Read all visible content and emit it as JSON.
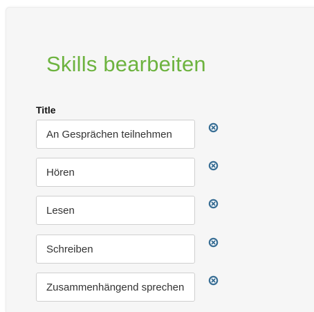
{
  "header": {
    "title": "Skills bearbeiten"
  },
  "form": {
    "field_label": "Title",
    "skills": [
      {
        "value": "An Gesprächen teilnehmen"
      },
      {
        "value": "Hören"
      },
      {
        "value": "Lesen"
      },
      {
        "value": "Schreiben"
      },
      {
        "value": "Zusammenhängend sprechen"
      }
    ],
    "remove_icon": "remove-circle-icon"
  },
  "colors": {
    "title": "#6db33f",
    "remove_icon": "#3a6f95",
    "panel_background": "#f6f6f6"
  }
}
